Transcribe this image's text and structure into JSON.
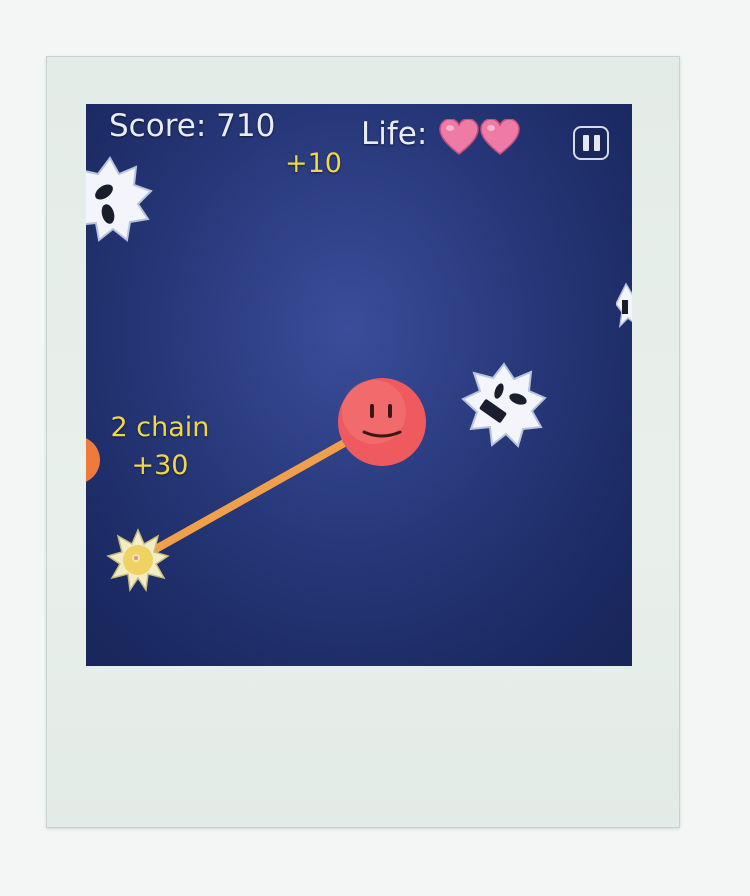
{
  "hud": {
    "score_label": "Score:",
    "score_value": "710",
    "life_label": "Life:",
    "lives": 2
  },
  "popups": {
    "bonus": "+10",
    "chain_label": "2 chain",
    "chain_bonus": "+30"
  },
  "colors": {
    "background": "#1e2d6b",
    "player": "#ef5a5f",
    "heart": "#f07aa6",
    "tether": "#f0a04a",
    "popup_text": "#f2d64a",
    "spiky_enemy": "#f3f5fb"
  },
  "icons": [
    "heart-icon",
    "pause-icon",
    "spiky-enemy",
    "player-ball",
    "spiked-anchor"
  ]
}
